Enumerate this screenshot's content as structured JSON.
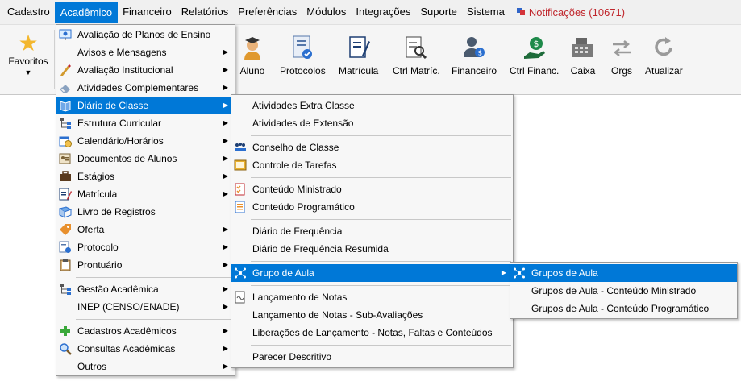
{
  "menubar": {
    "items": [
      "Cadastro",
      "Acadêmico",
      "Financeiro",
      "Relatórios",
      "Preferências",
      "Módulos",
      "Integrações",
      "Suporte",
      "Sistema"
    ],
    "notifications": "Notificações (10671)"
  },
  "toolbar": {
    "favorites": "Favoritos",
    "buttons": [
      "Aluno",
      "Protocolos",
      "Matrícula",
      "Ctrl Matríc.",
      "Financeiro",
      "Ctrl Financ.",
      "Caixa",
      "Orgs",
      "Atualizar"
    ]
  },
  "menu_academico": {
    "items": [
      "Avaliação de Planos de Ensino",
      "Avisos e Mensagens",
      "Avaliação Institucional",
      "Atividades Complementares",
      "Diário de Classe",
      "Estrutura Curricular",
      "Calendário/Horários",
      "Documentos de Alunos",
      "Estágios",
      "Matrícula",
      "Livro de Registros",
      "Oferta",
      "Protocolo",
      "Prontuário",
      "Gestão Acadêmica",
      "INEP (CENSO/ENADE)",
      "Cadastros Acadêmicos",
      "Consultas Acadêmicas",
      "Outros"
    ]
  },
  "menu_diario": {
    "items": [
      "Atividades Extra Classe",
      "Atividades de Extensão",
      "Conselho de Classe",
      "Controle de Tarefas",
      "Conteúdo Ministrado",
      "Conteúdo Programático",
      "Diário de Frequência",
      "Diário de Frequência Resumida",
      "Grupo de Aula",
      "Lançamento de Notas",
      "Lançamento de Notas - Sub-Avaliações",
      "Liberações de Lançamento - Notas, Faltas e Conteúdos",
      "Parecer Descritivo"
    ]
  },
  "menu_grupo": {
    "items": [
      "Grupos de Aula",
      "Grupos de Aula - Conteúdo Ministrado",
      "Grupos de Aula - Conteúdo Programático"
    ]
  },
  "colors": {
    "selection": "#0078d7",
    "notification": "#c0272d"
  }
}
